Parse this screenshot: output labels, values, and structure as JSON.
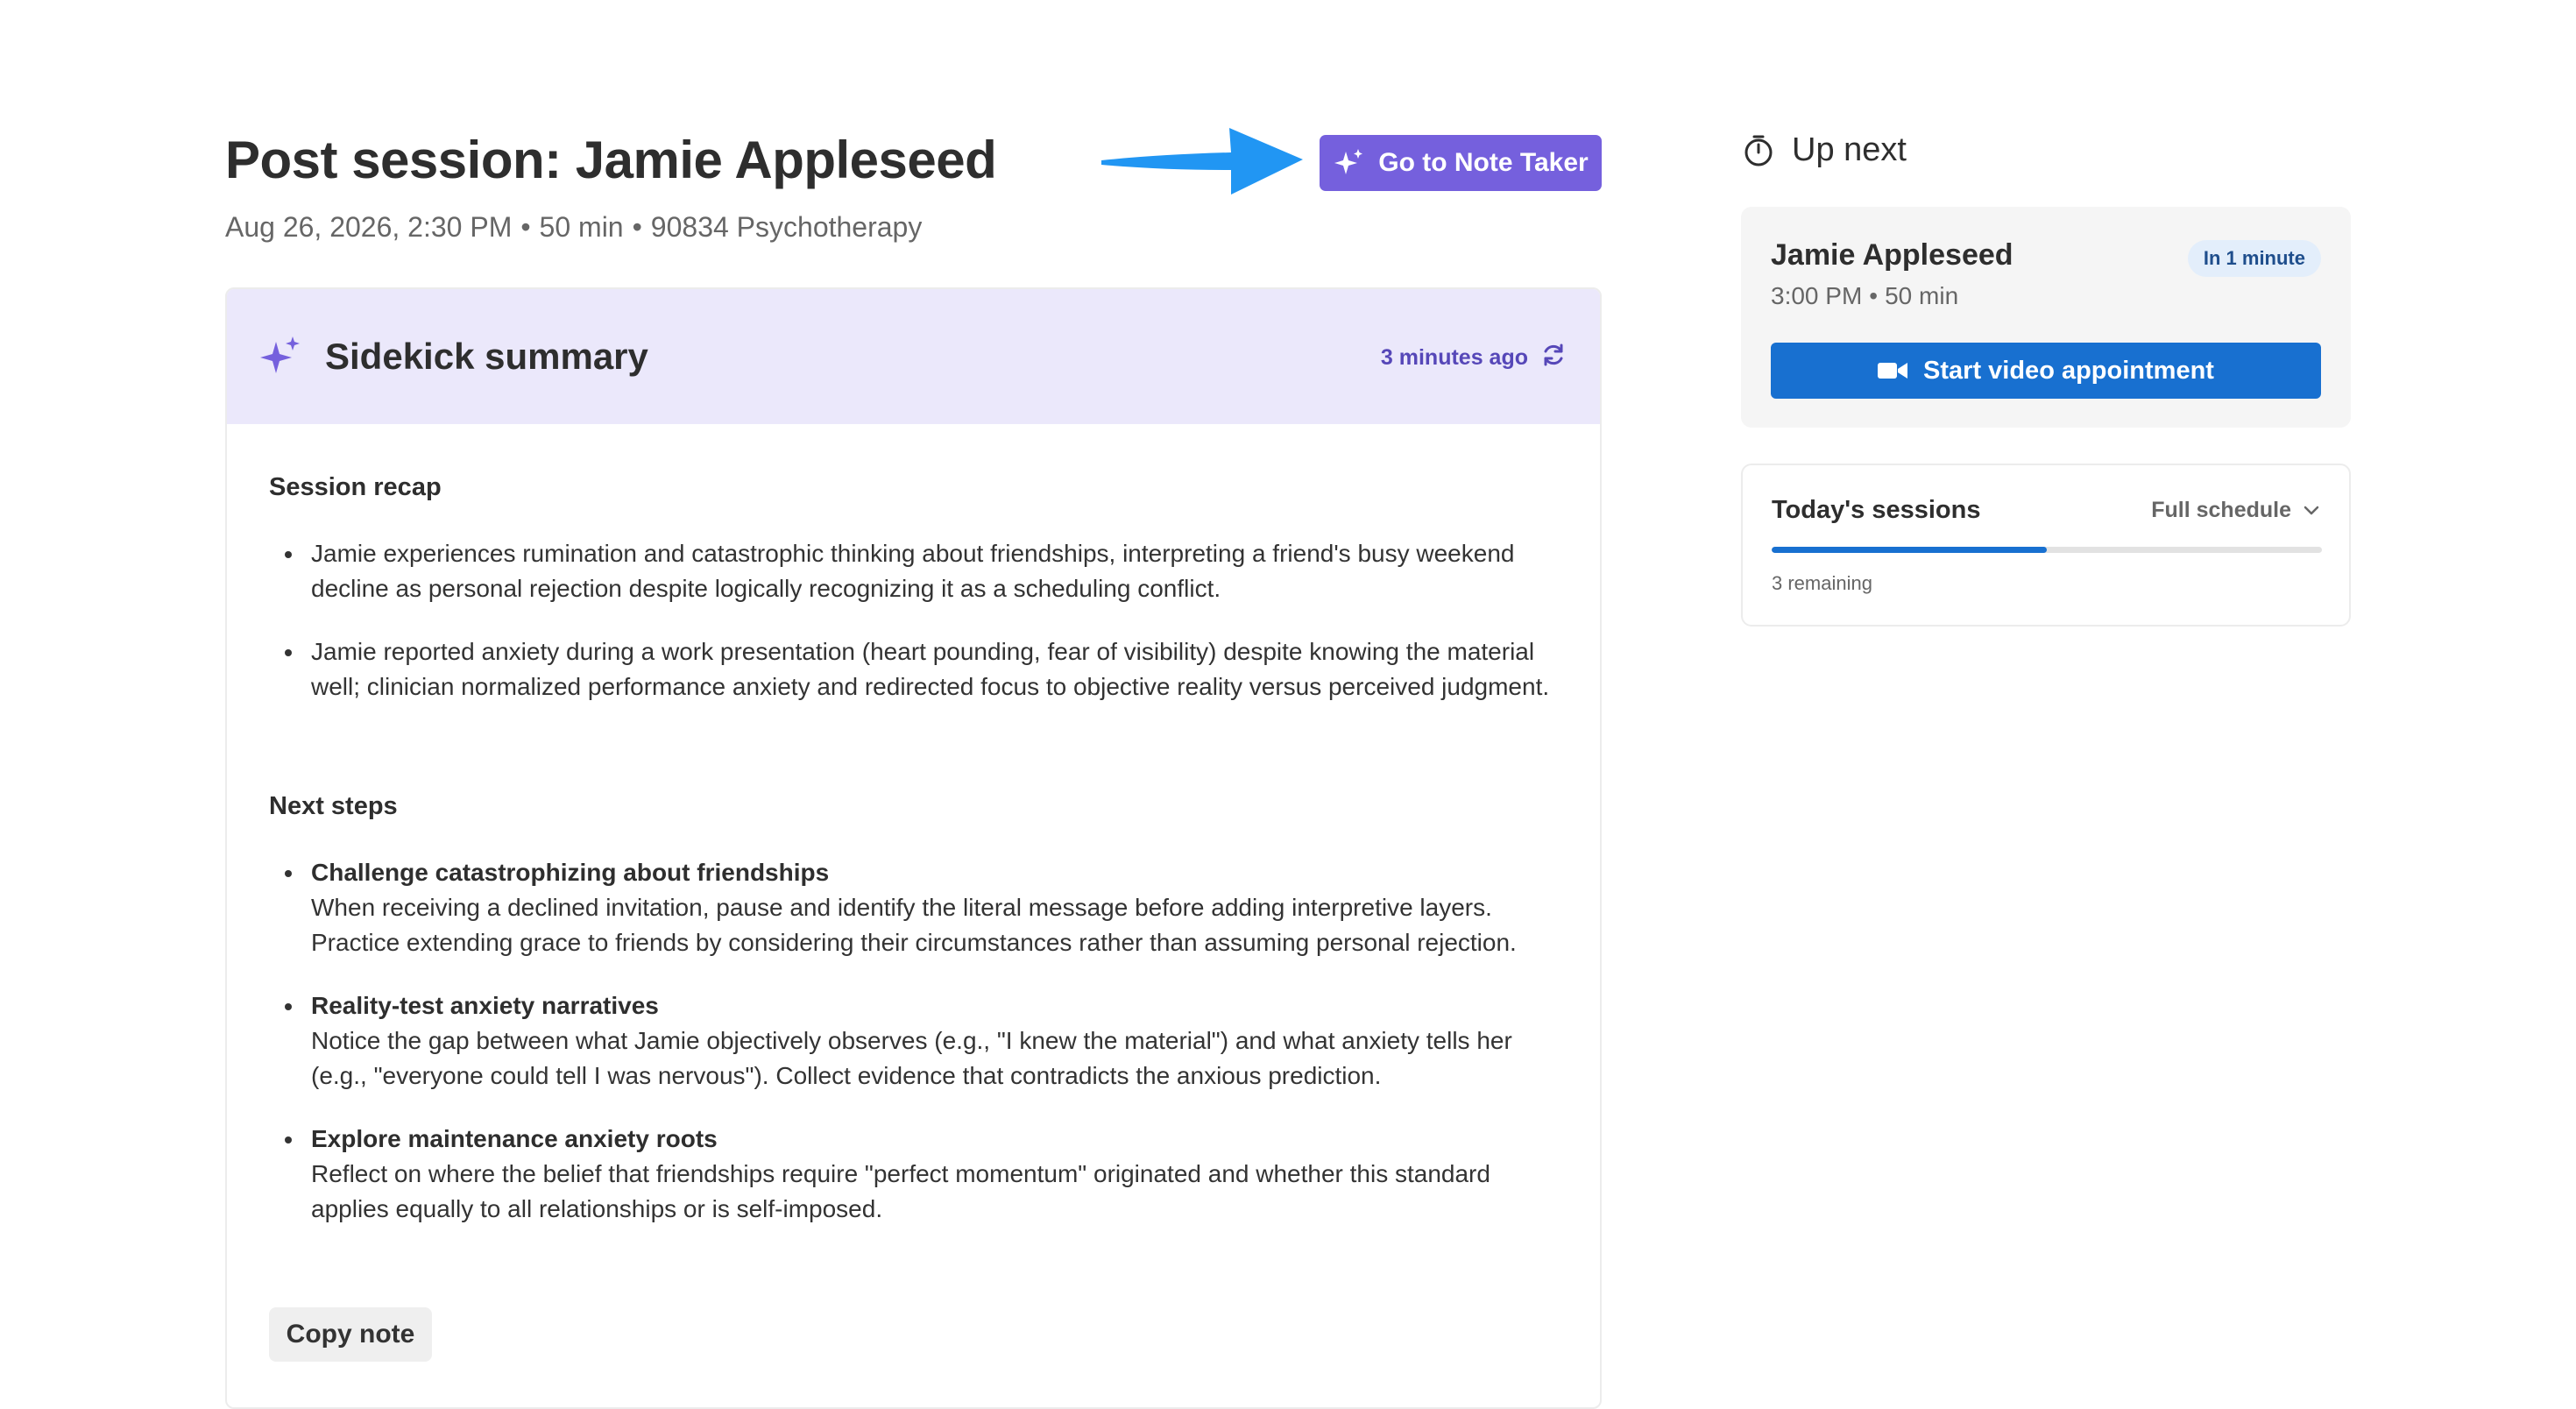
{
  "header": {
    "title": "Post session: Jamie Appleseed",
    "meta": [
      "Aug 26, 2026, 2:30 PM",
      "50 min",
      "90834 Psychotherapy"
    ],
    "separator": "•",
    "note_taker_label": "Go to Note Taker"
  },
  "summary": {
    "title": "Sidekick summary",
    "updated": "3 minutes ago",
    "recap_title": "Session recap",
    "recap": [
      "Jamie experiences rumination and catastrophic thinking about friendships, interpreting a friend's busy weekend decline as personal rejection despite logically recognizing it as a scheduling conflict.",
      "Jamie reported anxiety during a work presentation (heart pounding, fear of visibility) despite knowing the material well; clinician normalized performance anxiety and redirected focus to objective reality versus perceived judgment."
    ],
    "next_title": "Next steps",
    "next_steps": [
      {
        "title": "Challenge catastrophizing about friendships",
        "text": "When receiving a declined invitation, pause and identify the literal message before adding interpretive layers. Practice extending grace to friends by considering their circumstances rather than assuming personal rejection."
      },
      {
        "title": "Reality-test anxiety narratives",
        "text": "Notice the gap between what Jamie objectively observes (e.g., \"I knew the material\") and what anxiety tells her (e.g., \"everyone could tell I was nervous\"). Collect evidence that contradicts the anxious prediction."
      },
      {
        "title": "Explore maintenance anxiety roots",
        "text": "Reflect on where the belief that friendships require \"perfect momentum\" originated and whether this standard applies equally to all relationships or is self-imposed."
      }
    ],
    "copy_label": "Copy note"
  },
  "up_next": {
    "label": "Up next",
    "name": "Jamie Appleseed",
    "time": "3:00 PM",
    "duration": "50 min",
    "badge": "In 1 minute",
    "video_label": "Start video appointment"
  },
  "sessions": {
    "title": "Today's sessions",
    "schedule_label": "Full schedule",
    "progress_fraction": 0.5,
    "remaining": "3 remaining"
  },
  "colors": {
    "accent_purple": "#7560dd",
    "summary_bg": "#ebe8fb",
    "primary_blue": "#1870d0",
    "arrow_blue": "#2196f3"
  },
  "icons": [
    "sparkle-icon",
    "refresh-icon",
    "timer-icon",
    "video-camera-icon",
    "chevron-down-icon",
    "arrow-pointer-icon"
  ]
}
